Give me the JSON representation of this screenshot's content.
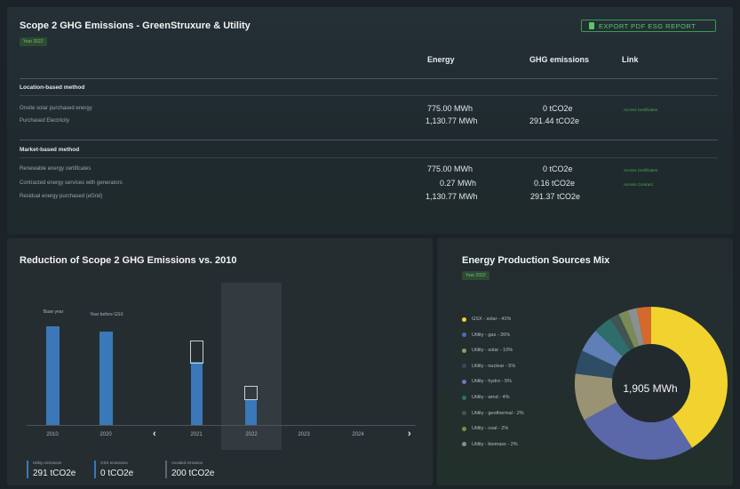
{
  "scope2": {
    "title": "Scope 2 GHG Emissions - GreenStruxure & Utility",
    "year_badge": "Year 2022",
    "export_label": "EXPORT PDF ESG REPORT",
    "columns": {
      "energy": "Energy",
      "ghg": "GHG emissions",
      "link": "Link"
    },
    "location": {
      "label": "Location-based method",
      "rows": [
        {
          "label": "Onsite solar purchased energy",
          "energy": "775.00 MWh",
          "ghg": "0 tCO2e",
          "link": "Access Certificates"
        },
        {
          "label": "Purchased Electricity",
          "energy": "1,130.77 MWh",
          "ghg": "291.44 tCO2e",
          "link": ""
        }
      ]
    },
    "market": {
      "label": "Market-based method",
      "rows": [
        {
          "label": "Renewable energy certificates",
          "energy": "775.00 MWh",
          "ghg": "0 tCO2e",
          "link": "Access Certificates"
        },
        {
          "label": "Contracted energy services with generators",
          "energy": "0.27 MWh",
          "ghg": "0.16 tCO2e",
          "link": "Access Contract"
        },
        {
          "label": "Residual energy purchased (eGrid)",
          "energy": "1,130.77 MWh",
          "ghg": "291.37 tCO2e",
          "link": ""
        }
      ]
    }
  },
  "reduction": {
    "title": "Reduction of Scope 2 GHG Emissions vs. 2010",
    "notes": {
      "base": "Base year",
      "before": "Year before GSX"
    },
    "years": [
      "2010",
      "2020",
      "2021",
      "2022",
      "2023",
      "2024"
    ],
    "nav": {
      "prev": "‹",
      "next": "›"
    },
    "legend": [
      {
        "label": "Utility emissions",
        "value": "291 tCO2e"
      },
      {
        "label": "GSX emissions",
        "value": "0 tCO2e"
      },
      {
        "label": "Avoided emission",
        "value": "200 tCO2e"
      }
    ],
    "accent": "#3b78b8"
  },
  "mix": {
    "title": "Energy Production Sources Mix",
    "year_badge": "Year 2022",
    "center_label": "1,905 MWh",
    "items": [
      {
        "label": "GSX - solar - 41%",
        "color": "#f2d22e",
        "pct": 41
      },
      {
        "label": "Utility - gas - 26%",
        "color": "#5a67a8",
        "pct": 26
      },
      {
        "label": "Utility - solar - 10%",
        "color": "#9a9373",
        "pct": 10
      },
      {
        "label": "Utility - nuclear - 5%",
        "color": "#2c4d63",
        "pct": 5
      },
      {
        "label": "Utility - hydro - 5%",
        "color": "#5f7fb6",
        "pct": 5
      },
      {
        "label": "Utility - wind - 4%",
        "color": "#2d6e6a",
        "pct": 4
      },
      {
        "label": "Utility - geothermal - 2%",
        "color": "#425450",
        "pct": 2
      },
      {
        "label": "Utility - coal - 2%",
        "color": "#7a8c55",
        "pct": 2
      },
      {
        "label": "Utility - biomass - 2%",
        "color": "#8a9090",
        "pct": 2
      }
    ],
    "accent": "#d46a2a"
  }
}
